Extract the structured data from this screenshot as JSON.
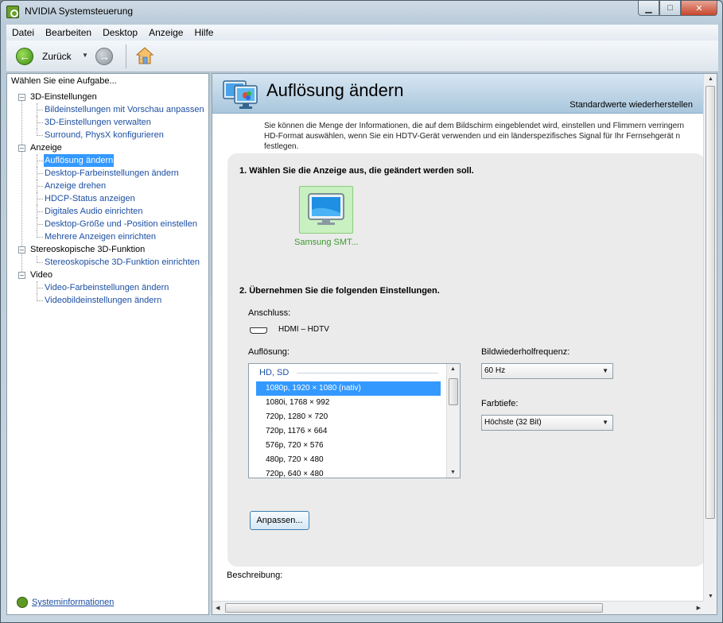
{
  "window": {
    "title": "NVIDIA Systemsteuerung",
    "controls": {
      "minimize": "▁",
      "maximize": "□",
      "close": "✕"
    }
  },
  "menubar": {
    "items": [
      "Datei",
      "Bearbeiten",
      "Desktop",
      "Anzeige",
      "Hilfe"
    ]
  },
  "toolbar": {
    "back_label": "Zurück",
    "icons": [
      "back-arrow-icon",
      "forward-arrow-icon",
      "home-icon"
    ]
  },
  "sidebar": {
    "header": "Wählen Sie eine Aufgabe...",
    "tree": [
      {
        "label": "3D-Einstellungen",
        "children": [
          "Bildeinstellungen mit Vorschau anpassen",
          "3D-Einstellungen verwalten",
          "Surround, PhysX konfigurieren"
        ]
      },
      {
        "label": "Anzeige",
        "children": [
          "Auflösung ändern",
          "Desktop-Farbeinstellungen ändern",
          "Anzeige drehen",
          "HDCP-Status anzeigen",
          "Digitales Audio einrichten",
          "Desktop-Größe und -Position einstellen",
          "Mehrere Anzeigen einrichten"
        ]
      },
      {
        "label": "Stereoskopische 3D-Funktion",
        "children": [
          "Stereoskopische 3D-Funktion einrichten"
        ]
      },
      {
        "label": "Video",
        "children": [
          "Video-Farbeinstellungen ändern",
          "Videobildeinstellungen ändern"
        ]
      }
    ],
    "selected": "Auflösung ändern",
    "footer_link": "Systeminformationen"
  },
  "main": {
    "title": "Auflösung ändern",
    "restore_link": "Standardwerte wiederherstellen",
    "intro_line1": "Sie können die Menge der Informationen, die auf dem Bildschirm eingeblendet wird, einstellen und Flimmern verringern",
    "intro_line2": "HD-Format auswählen, wenn Sie ein HDTV-Gerät verwenden und ein länderspezifisches Signal für Ihr Fernsehgerät n",
    "intro_line3": "festlegen.",
    "step1": "1. Wählen Sie die Anzeige aus, die geändert werden soll.",
    "display_name": "Samsung SMT...",
    "step2": "2. Übernehmen Sie die folgenden Einstellungen.",
    "connection_label": "Anschluss:",
    "connection_value": "HDMI – HDTV",
    "resolution_label": "Auflösung:",
    "resolution_group": "HD, SD",
    "resolutions": [
      "1080p, 1920 × 1080 (nativ)",
      "1080i, 1768 × 992",
      "720p, 1280 × 720",
      "720p, 1176 × 664",
      "576p, 720 × 576",
      "480p, 720 × 480",
      "720p, 640 × 480"
    ],
    "selected_resolution": "1080p, 1920 × 1080 (nativ)",
    "refresh_label": "Bildwiederholfrequenz:",
    "refresh_value": "60 Hz",
    "depth_label": "Farbtiefe:",
    "depth_value": "Höchste (32 Bit)",
    "adjust_button": "Anpassen...",
    "description_label": "Beschreibung:"
  },
  "colors": {
    "selection": "#3399ff",
    "link": "#1c4fa3",
    "banner": "#a9c6dc",
    "display_tile": "#c8f0c0",
    "display_label": "#3a9a2e"
  }
}
